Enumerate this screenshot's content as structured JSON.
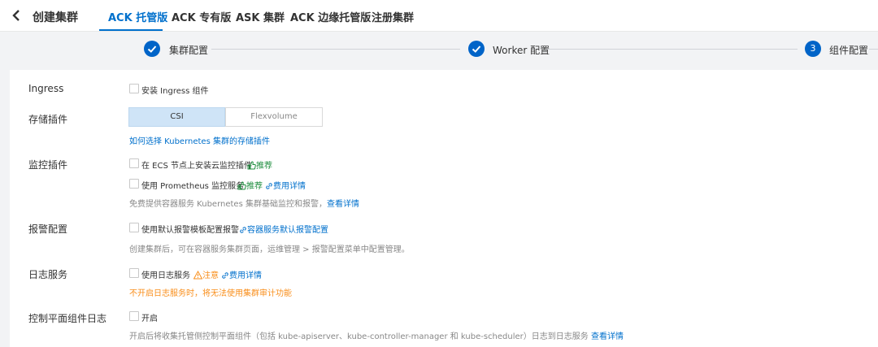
{
  "header": {
    "title": "创建集群",
    "tabs": [
      {
        "label": "ACK 托管版",
        "active": true
      },
      {
        "label": "ACK 专有版"
      },
      {
        "label": "ASK 集群"
      },
      {
        "label": "ACK 边缘托管版"
      },
      {
        "label": "注册集群"
      }
    ]
  },
  "steps": [
    {
      "label": "集群配置",
      "status": "done"
    },
    {
      "label": "Worker 配置",
      "status": "done"
    },
    {
      "label": "组件配置",
      "status": "current",
      "number": "3"
    }
  ],
  "colors": {
    "accent": "#0070cc",
    "step": "#0064c8",
    "green": "#1e8e3e",
    "warning": "#f98e1a"
  },
  "ingress": {
    "label": "Ingress",
    "checkbox_label": "安装 Ingress 组件"
  },
  "storage": {
    "label": "存储插件",
    "options": [
      "CSI",
      "Flexvolume"
    ],
    "selected": "CSI",
    "help_link": "如何选择 Kubernetes 集群的存储插件"
  },
  "monitor": {
    "label": "监控插件",
    "ecs_label": "在 ECS 节点上安装云监控插件",
    "recommend": "推荐",
    "prom_label": "使用 Prometheus 监控服务",
    "recommend2": "推荐",
    "fee_link": "费用详情",
    "hint": "免费提供容器服务 Kubernetes 集群基础监控和报警，",
    "hint_link": "查看详情"
  },
  "alert": {
    "label": "报警配置",
    "checkbox_label": "使用默认报警模板配置报警",
    "link": "容器服务默认报警配置",
    "hint": "创建集群后，可在容器服务集群页面，运维管理 > 报警配置菜单中配置管理。"
  },
  "log": {
    "label": "日志服务",
    "checkbox_label": "使用日志服务",
    "notice": "注意",
    "fee_link": "费用详情",
    "warning": "不开启日志服务时，将无法使用集群审计功能"
  },
  "control_log": {
    "label": "控制平面组件日志",
    "checkbox_label": "开启",
    "hint": "开启后将收集托管侧控制平面组件（包括 kube-apiserver、kube-controller-manager 和 kube-scheduler）日志到日志服务",
    "hint_link": "查看详情"
  }
}
